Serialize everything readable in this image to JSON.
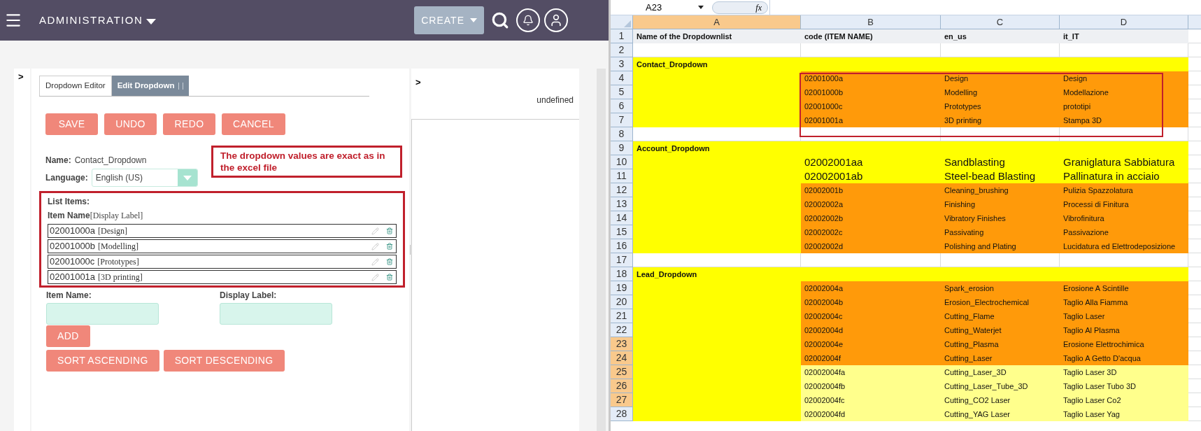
{
  "topbar": {
    "module": "ADMINISTRATION",
    "create": "CREATE"
  },
  "left_toggle": ">",
  "tabs": [
    {
      "label": "Dropdown Editor",
      "selected": false
    },
    {
      "label": "Edit Dropdown",
      "selected": true
    }
  ],
  "actions": [
    "SAVE",
    "UNDO",
    "REDO",
    "CANCEL"
  ],
  "annotation": "The dropdown values are exact as in the excel file",
  "name_label": "Name:",
  "name_value": "Contact_Dropdown",
  "language_label": "Language:",
  "language_value": "English (US)",
  "list_title": "List Items:",
  "list_header": {
    "name": "Item Name",
    "label": "[Display Label]"
  },
  "list_items": [
    {
      "name": "02001000a",
      "label": "[Design]"
    },
    {
      "name": "02001000b",
      "label": "[Modelling]"
    },
    {
      "name": "02001000c",
      "label": "[Prototypes]"
    },
    {
      "name": "02001001a",
      "label": "[3D printing]"
    }
  ],
  "item_name_label": "Item Name:",
  "display_label_label": "Display Label:",
  "add": "ADD",
  "sort_buttons": [
    "SORT ASCENDING",
    "SORT DESCENDING"
  ],
  "right_panel": {
    "toggle": ">",
    "text": "undefined"
  },
  "sheet": {
    "name_box": "A23",
    "formula_label": "fx",
    "columns": [
      {
        "label": "A",
        "selected": true
      },
      {
        "label": "B",
        "selected": false
      },
      {
        "label": "C",
        "selected": false
      },
      {
        "label": "D",
        "selected": false
      }
    ],
    "rows": [
      {
        "number": "1",
        "selected": false,
        "kind": "header",
        "cells": [
          "Name of the Dropdownlist",
          "code (ITEM NAME)",
          "en_us",
          "it_IT"
        ]
      },
      {
        "number": "2",
        "selected": false,
        "kind": "blank"
      },
      {
        "number": "3",
        "selected": false,
        "kind": "group",
        "cells": [
          "Contact_Dropdown"
        ]
      },
      {
        "number": "4",
        "selected": false,
        "kind": "item",
        "cells": [
          "02001000a",
          "Design",
          "Design"
        ]
      },
      {
        "number": "5",
        "selected": false,
        "kind": "item",
        "cells": [
          "02001000b",
          "Modelling",
          "Modellazione"
        ]
      },
      {
        "number": "6",
        "selected": false,
        "kind": "item",
        "cells": [
          "02001000c",
          "Prototypes",
          "prototipi"
        ]
      },
      {
        "number": "7",
        "selected": false,
        "kind": "item",
        "cells": [
          "02001001a",
          "3D printing",
          "Stampa 3D"
        ]
      },
      {
        "number": "8",
        "selected": false,
        "kind": "blank"
      },
      {
        "number": "9",
        "selected": false,
        "kind": "group",
        "cells": [
          "Account_Dropdown"
        ]
      },
      {
        "number": "10",
        "selected": false,
        "kind": "large",
        "cells": [
          "02002001aa",
          "Sandblasting",
          "Graniglatura Sabbiatura"
        ]
      },
      {
        "number": "11",
        "selected": false,
        "kind": "large",
        "cells": [
          "02002001ab",
          "Steel-bead Blasting",
          "Pallinatura in acciaio"
        ]
      },
      {
        "number": "12",
        "selected": false,
        "kind": "item",
        "cells": [
          "02002001b",
          "Cleaning_brushing",
          "Pulizia Spazzolatura"
        ]
      },
      {
        "number": "13",
        "selected": false,
        "kind": "item",
        "cells": [
          "02002002a",
          "Finishing",
          "Processi di Finitura"
        ]
      },
      {
        "number": "14",
        "selected": false,
        "kind": "item",
        "cells": [
          "02002002b",
          "Vibratory Finishes",
          "Vibrofinitura"
        ]
      },
      {
        "number": "15",
        "selected": false,
        "kind": "item",
        "cells": [
          "02002002c",
          "Passivating",
          "Passivazione"
        ]
      },
      {
        "number": "16",
        "selected": false,
        "kind": "item",
        "cells": [
          "02002002d",
          "Polishing and Plating",
          "Lucidatura ed Elettrodeposizione"
        ]
      },
      {
        "number": "17",
        "selected": false,
        "kind": "blank"
      },
      {
        "number": "18",
        "selected": false,
        "kind": "group",
        "cells": [
          "Lead_Dropdown"
        ]
      },
      {
        "number": "19",
        "selected": false,
        "kind": "item",
        "cells": [
          "02002004a",
          "Spark_erosion",
          "Erosione A Scintille"
        ]
      },
      {
        "number": "20",
        "selected": false,
        "kind": "item",
        "cells": [
          "02002004b",
          "Erosion_Electrochemical",
          "Taglio Alla Fiamma"
        ]
      },
      {
        "number": "21",
        "selected": false,
        "kind": "item",
        "cells": [
          "02002004c",
          "Cutting_Flame",
          "Taglio Laser"
        ]
      },
      {
        "number": "22",
        "selected": false,
        "kind": "item",
        "cells": [
          "02002004d",
          "Cutting_Waterjet",
          "Taglio Al Plasma"
        ]
      },
      {
        "number": "23",
        "selected": true,
        "kind": "item",
        "cells": [
          "02002004e",
          "Cutting_Plasma",
          "Erosione Elettrochimica"
        ]
      },
      {
        "number": "24",
        "selected": true,
        "kind": "item",
        "cells": [
          "02002004f",
          "Cutting_Laser",
          "Taglio A Getto D'acqua"
        ]
      },
      {
        "number": "25",
        "selected": true,
        "kind": "light",
        "cells": [
          "02002004fa",
          "Cutting_Laser_3D",
          "Taglio Laser 3D"
        ]
      },
      {
        "number": "26",
        "selected": true,
        "kind": "light",
        "cells": [
          "02002004fb",
          "Cutting_Laser_Tube_3D",
          "Taglio Laser Tubo 3D"
        ]
      },
      {
        "number": "27",
        "selected": true,
        "kind": "light",
        "cells": [
          "02002004fc",
          "Cutting_CO2 Laser",
          "Taglio Laser Co2"
        ]
      },
      {
        "number": "28",
        "selected": false,
        "kind": "light",
        "cells": [
          "02002004fd",
          "Cutting_YAG Laser",
          "Taglio Laser Yag"
        ]
      }
    ]
  }
}
